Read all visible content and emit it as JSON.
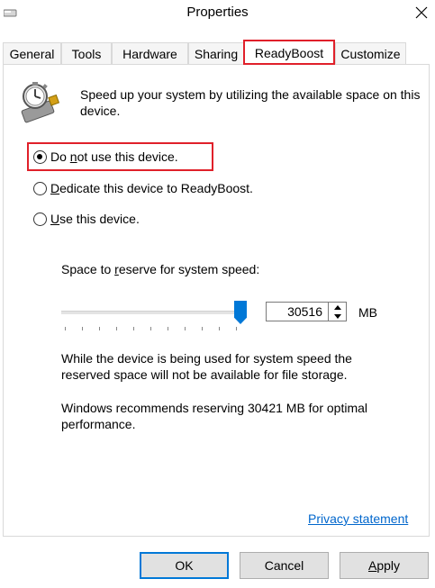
{
  "window": {
    "title": "Properties"
  },
  "tabs": [
    {
      "label": "General"
    },
    {
      "label": "Tools"
    },
    {
      "label": "Hardware"
    },
    {
      "label": "Sharing"
    },
    {
      "label": "ReadyBoost",
      "active": true
    },
    {
      "label": "Customize"
    }
  ],
  "readyboost": {
    "intro": "Speed up your system by utilizing the available space on this device.",
    "options": [
      {
        "pre": "Do ",
        "key": "n",
        "post": "ot use this device.",
        "selected": true
      },
      {
        "pre": "",
        "key": "D",
        "post": "edicate this device to ReadyBoost.",
        "selected": false
      },
      {
        "pre": "",
        "key": "U",
        "post": "se this device.",
        "selected": false
      }
    ],
    "space_label_pre": "Space to ",
    "space_label_key": "r",
    "space_label_post": "eserve for system speed:",
    "reserve_value": "30516",
    "reserve_unit": "MB",
    "slider_level": 1.0,
    "note1": "While the device is being used for system speed the reserved space will not be available for file storage.",
    "note2": "Windows recommends reserving 30421 MB for optimal performance.",
    "privacy_link": "Privacy statement"
  },
  "buttons": {
    "ok": "OK",
    "cancel": "Cancel",
    "apply_key": "A",
    "apply_rest": "pply"
  },
  "colors": {
    "accent": "#0078d7",
    "highlight": "#e0202a",
    "link": "#0066cc"
  }
}
